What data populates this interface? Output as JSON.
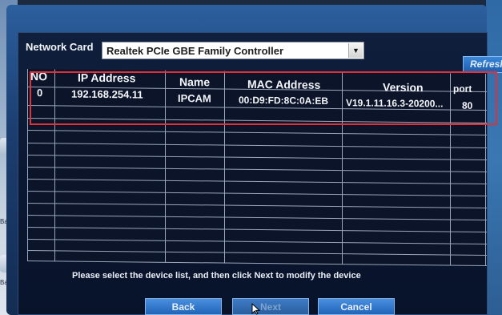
{
  "desktop": {
    "left_label": "Ba",
    "left_label2": "Ba"
  },
  "network_card": {
    "label": "Network Card",
    "selected": "Realtek PCIe GBE Family Controller",
    "refresh_label": "Refresh"
  },
  "table": {
    "columns": [
      "NO",
      "IP Address",
      "Name",
      "MAC Address",
      "Version",
      "port"
    ],
    "rows": [
      {
        "no": "0",
        "ip": "192.168.254.11",
        "name": "IPCAM",
        "mac": "00:D9:FD:8C:0A:EB",
        "version": "V19.1.11.16.3-20200...",
        "port": "80"
      }
    ]
  },
  "hint": "Please select the device list, and then click Next to modify the device",
  "buttons": {
    "back": "Back",
    "next": "Next",
    "cancel": "Cancel"
  },
  "colors": {
    "highlight": "#e0303a",
    "button": "#2064b8"
  }
}
